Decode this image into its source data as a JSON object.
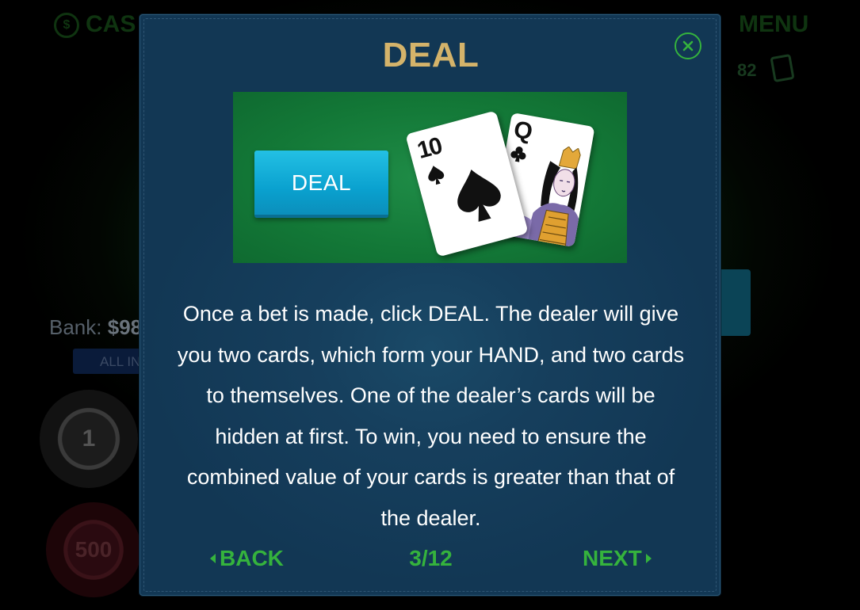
{
  "background": {
    "cash_label": "CAS",
    "cash_icon_text": "$",
    "menu_label": "MENU",
    "deck_count": "82",
    "bank_label": "Bank:",
    "bank_value": "$98",
    "all_in_label": "ALL IN",
    "chips": [
      "1",
      "500"
    ]
  },
  "modal": {
    "title": "DEAL",
    "illustration": {
      "button_label": "DEAL",
      "cards": [
        {
          "rank": "10",
          "suit": "spades"
        },
        {
          "rank": "Q",
          "suit": "clubs"
        }
      ]
    },
    "body_text": "Once a bet is made, click DEAL. The dealer will give you two cards, which form your HAND, and two cards to themselves. One of the dealer’s cards will be hidden at first. To win, you need to ensure the combined value of your cards is greater than that of the dealer.",
    "back_label": "BACK",
    "next_label": "NEXT",
    "page_indicator": "3/12"
  },
  "colors": {
    "accent_green": "#35b33d",
    "title_gold": "#d4b36a",
    "modal_bg": "#163f5d",
    "deal_button": "#0aa1cf"
  }
}
